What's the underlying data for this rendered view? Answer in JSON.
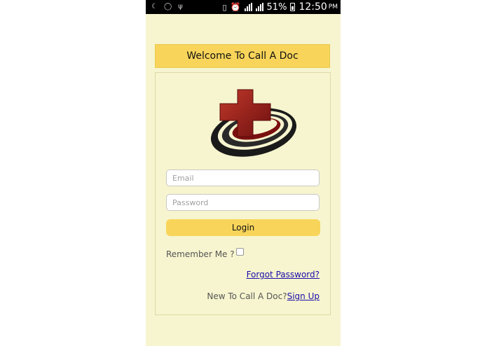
{
  "status_bar": {
    "battery_percent": "51%",
    "time": "12:50",
    "am_pm": "PM"
  },
  "header": {
    "title": "Welcome To Call A Doc"
  },
  "form": {
    "email_placeholder": "Email",
    "password_placeholder": "Password",
    "login_label": "Login",
    "remember_label": "Remember Me ?",
    "remember_checked": false,
    "forgot_label": "Forgot Password?",
    "new_user_text": "New To Call A Doc?",
    "signup_label": "Sign Up"
  },
  "colors": {
    "background": "#f7f5cf",
    "accent": "#f8d55a",
    "link": "#1a0dab",
    "logo_red": "#9b1c1c"
  },
  "icons": {
    "logo": "red-cross-orbit-logo"
  }
}
